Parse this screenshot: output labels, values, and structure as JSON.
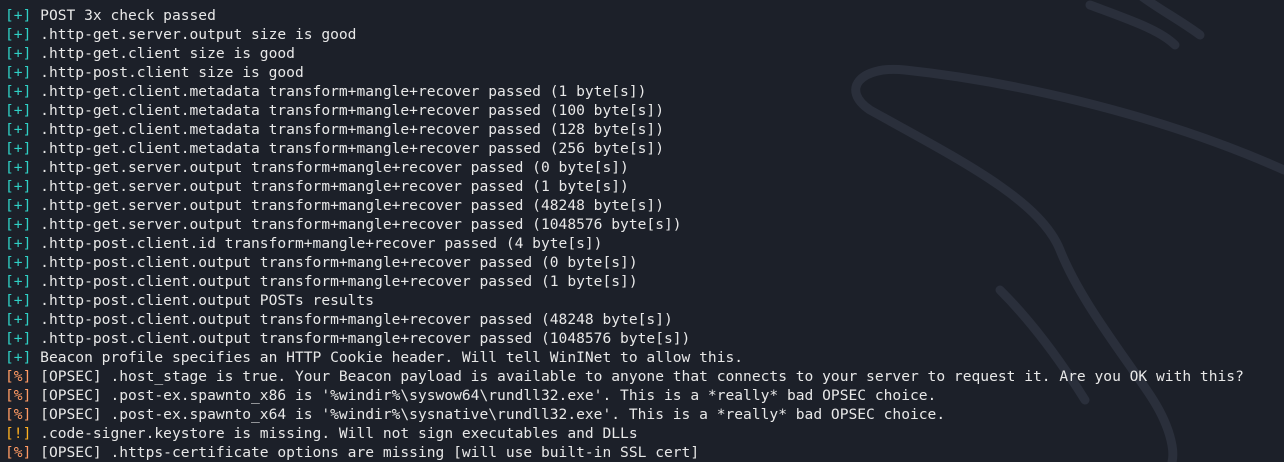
{
  "colors": {
    "background": "#1c2029",
    "text": "#e8e8e8",
    "tag_ok": "#2fd0c5",
    "tag_warn": "#ff9a63",
    "tag_err": "#ffb020"
  },
  "terminal": {
    "lines": [
      {
        "tag": "[+]",
        "kind": "ok",
        "text": "POST 3x check passed"
      },
      {
        "tag": "[+]",
        "kind": "ok",
        "text": ".http-get.server.output size is good"
      },
      {
        "tag": "[+]",
        "kind": "ok",
        "text": ".http-get.client size is good"
      },
      {
        "tag": "[+]",
        "kind": "ok",
        "text": ".http-post.client size is good"
      },
      {
        "tag": "[+]",
        "kind": "ok",
        "text": ".http-get.client.metadata transform+mangle+recover passed (1 byte[s])"
      },
      {
        "tag": "[+]",
        "kind": "ok",
        "text": ".http-get.client.metadata transform+mangle+recover passed (100 byte[s])"
      },
      {
        "tag": "[+]",
        "kind": "ok",
        "text": ".http-get.client.metadata transform+mangle+recover passed (128 byte[s])"
      },
      {
        "tag": "[+]",
        "kind": "ok",
        "text": ".http-get.client.metadata transform+mangle+recover passed (256 byte[s])"
      },
      {
        "tag": "[+]",
        "kind": "ok",
        "text": ".http-get.server.output transform+mangle+recover passed (0 byte[s])"
      },
      {
        "tag": "[+]",
        "kind": "ok",
        "text": ".http-get.server.output transform+mangle+recover passed (1 byte[s])"
      },
      {
        "tag": "[+]",
        "kind": "ok",
        "text": ".http-get.server.output transform+mangle+recover passed (48248 byte[s])"
      },
      {
        "tag": "[+]",
        "kind": "ok",
        "text": ".http-get.server.output transform+mangle+recover passed (1048576 byte[s])"
      },
      {
        "tag": "[+]",
        "kind": "ok",
        "text": ".http-post.client.id transform+mangle+recover passed (4 byte[s])"
      },
      {
        "tag": "[+]",
        "kind": "ok",
        "text": ".http-post.client.output transform+mangle+recover passed (0 byte[s])"
      },
      {
        "tag": "[+]",
        "kind": "ok",
        "text": ".http-post.client.output transform+mangle+recover passed (1 byte[s])"
      },
      {
        "tag": "[+]",
        "kind": "ok",
        "text": ".http-post.client.output POSTs results"
      },
      {
        "tag": "[+]",
        "kind": "ok",
        "text": ".http-post.client.output transform+mangle+recover passed (48248 byte[s])"
      },
      {
        "tag": "[+]",
        "kind": "ok",
        "text": ".http-post.client.output transform+mangle+recover passed (1048576 byte[s])"
      },
      {
        "tag": "[+]",
        "kind": "ok",
        "text": "Beacon profile specifies an HTTP Cookie header. Will tell WinINet to allow this."
      },
      {
        "tag": "[%]",
        "kind": "warn",
        "text": "[OPSEC] .host_stage is true. Your Beacon payload is available to anyone that connects to your server to request it. Are you OK with this?"
      },
      {
        "tag": "[%]",
        "kind": "warn",
        "text": "[OPSEC] .post-ex.spawnto_x86 is '%windir%\\syswow64\\rundll32.exe'. This is a *really* bad OPSEC choice."
      },
      {
        "tag": "[%]",
        "kind": "warn",
        "text": "[OPSEC] .post-ex.spawnto_x64 is '%windir%\\sysnative\\rundll32.exe'. This is a *really* bad OPSEC choice."
      },
      {
        "tag": "[!]",
        "kind": "err",
        "text": ".code-signer.keystore is missing. Will not sign executables and DLLs"
      },
      {
        "tag": "[%]",
        "kind": "warn",
        "text": "[OPSEC] .https-certificate options are missing [will use built-in SSL cert]"
      }
    ]
  }
}
